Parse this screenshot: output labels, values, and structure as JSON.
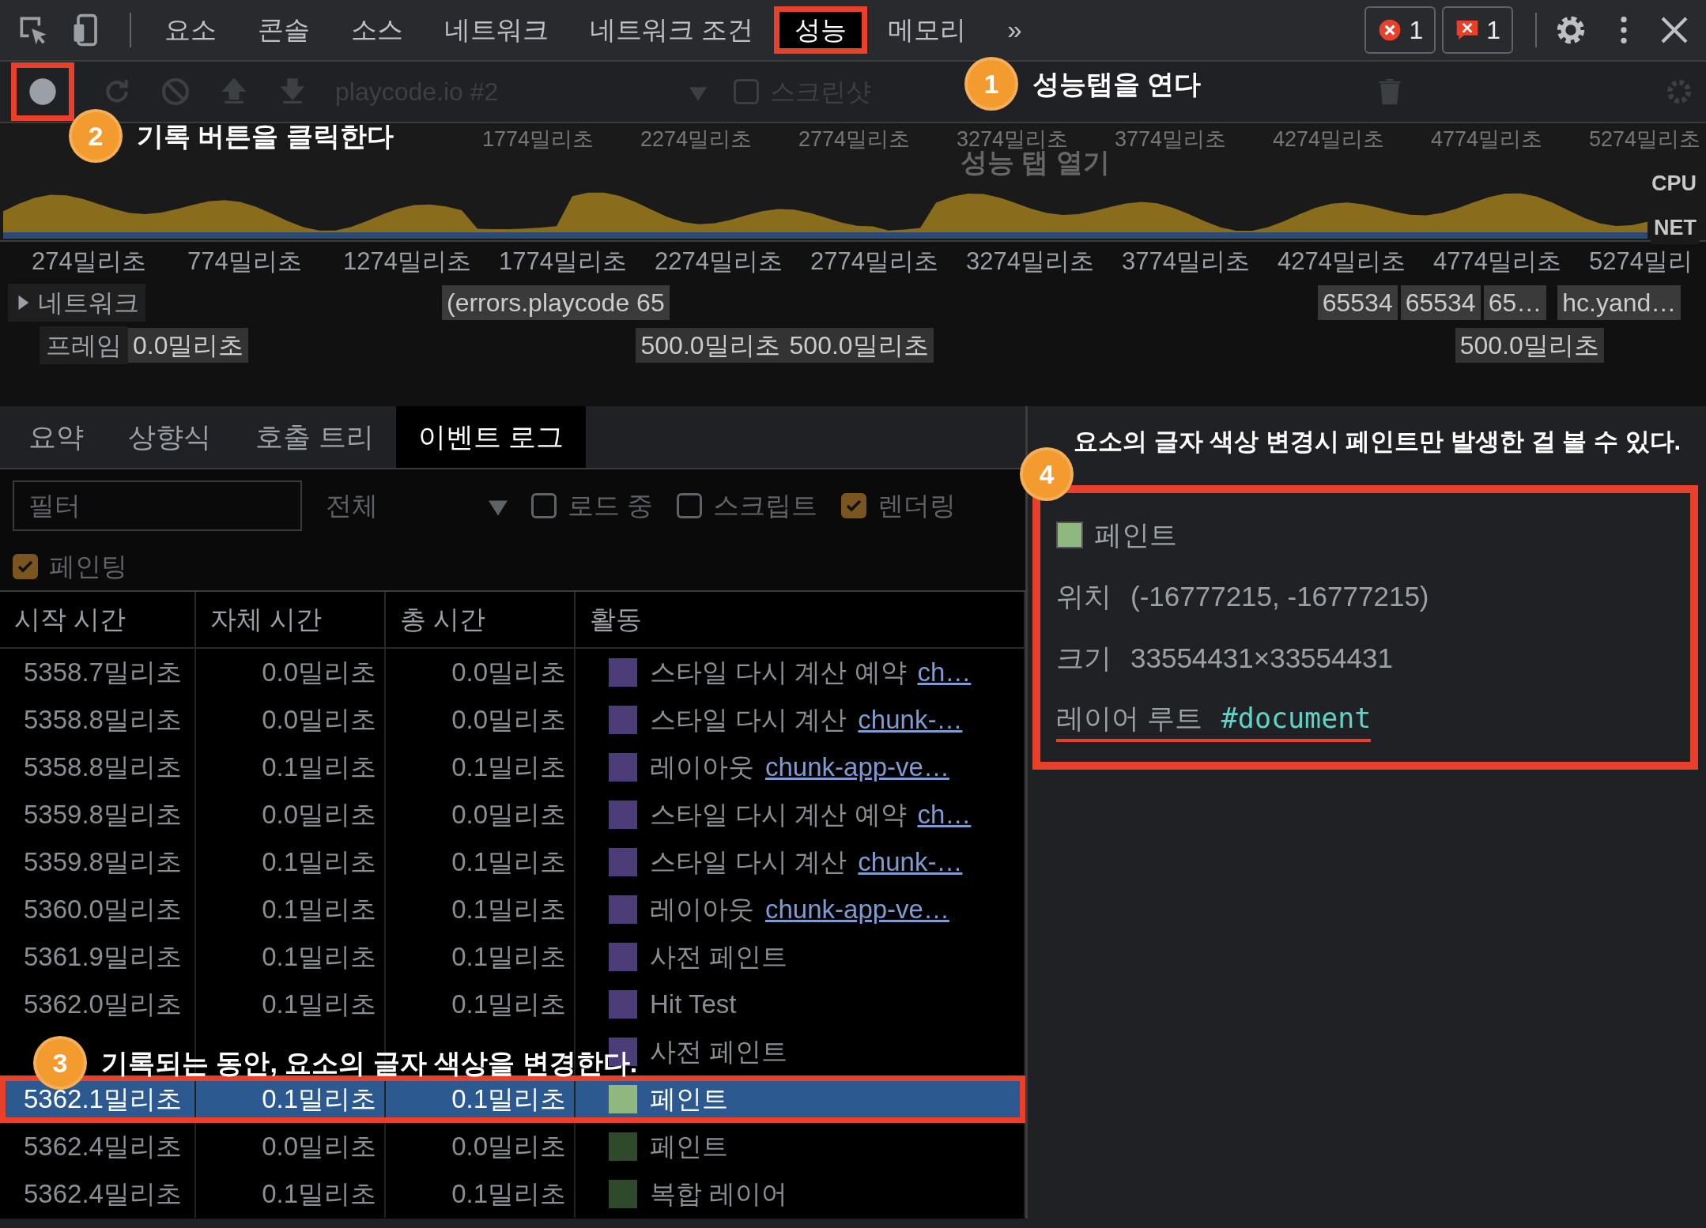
{
  "tabs": [
    {
      "label": "요소",
      "selected": false,
      "highlighted": false
    },
    {
      "label": "콘솔",
      "selected": false,
      "highlighted": false
    },
    {
      "label": "소스",
      "selected": false,
      "highlighted": false
    },
    {
      "label": "네트워크",
      "selected": false,
      "highlighted": false
    },
    {
      "label": "네트워크 조건",
      "selected": false,
      "highlighted": false
    },
    {
      "label": "성능",
      "selected": true,
      "highlighted": true
    },
    {
      "label": "메모리",
      "selected": false,
      "highlighted": false
    },
    {
      "label": "»",
      "selected": false,
      "highlighted": false
    }
  ],
  "counters": [
    {
      "kind": "error",
      "count": "1"
    },
    {
      "kind": "issue",
      "count": "1"
    }
  ],
  "toolbar": {
    "record_highlighted": true,
    "target": "playcode.io #2",
    "checkboxes": [
      {
        "label": "스크린샷",
        "checked": false
      }
    ]
  },
  "overview": {
    "ticks": [
      "1774밀리초",
      "2274밀리초",
      "2774밀리초",
      "3274밀리초",
      "3774밀리초",
      "4274밀리초",
      "4774밀리초",
      "5274밀리초"
    ],
    "screenshot_text": "성능 탭 열기",
    "cpu_label": "CPU",
    "net_label": "NET"
  },
  "ruler": [
    "274밀리초",
    "774밀리초",
    "1274밀리초",
    "1774밀리초",
    "2274밀리초",
    "2774밀리초",
    "3274밀리초",
    "3774밀리초",
    "4274밀리초",
    "4774밀리초",
    "5274밀리"
  ],
  "network_track": {
    "label": "네트워크",
    "expanded": false,
    "segments": [
      "(errors.playcode 65",
      "65534",
      "65534",
      "65…",
      "hc.yand…"
    ]
  },
  "frames_track": {
    "label": "프레임",
    "segments": [
      "0.0밀리초",
      "500.0밀리초",
      "500.0밀리초",
      "500.0밀리초"
    ]
  },
  "detail_tabs": [
    {
      "label": "요약",
      "selected": false
    },
    {
      "label": "상향식",
      "selected": false
    },
    {
      "label": "호출 트리",
      "selected": false
    },
    {
      "label": "이벤트 로그",
      "selected": true
    }
  ],
  "filter": {
    "placeholder": "필터",
    "category": "전체",
    "checkboxes": [
      {
        "label": "로드 중",
        "checked": false
      },
      {
        "label": "스크립트",
        "checked": false
      },
      {
        "label": "렌더링",
        "checked": true
      },
      {
        "label": "페인팅",
        "checked": true
      }
    ]
  },
  "table": {
    "columns": [
      "시작 시간",
      "자체 시간",
      "총 시간",
      "활동"
    ],
    "rows": [
      {
        "start": "5358.7밀리초",
        "self": "0.0밀리초",
        "total": "0.0밀리초",
        "activity": "스타일 다시 계산 예약",
        "link": "ch…",
        "color": "#4c3d78",
        "selected": false
      },
      {
        "start": "5358.8밀리초",
        "self": "0.0밀리초",
        "total": "0.0밀리초",
        "activity": "스타일 다시 계산",
        "link": "chunk-…",
        "color": "#4c3d78",
        "selected": false
      },
      {
        "start": "5358.8밀리초",
        "self": "0.1밀리초",
        "total": "0.1밀리초",
        "activity": "레이아웃",
        "link": "chunk-app-ve…",
        "color": "#4c3d78",
        "selected": false
      },
      {
        "start": "5359.8밀리초",
        "self": "0.0밀리초",
        "total": "0.0밀리초",
        "activity": "스타일 다시 계산 예약",
        "link": "ch…",
        "color": "#4c3d78",
        "selected": false
      },
      {
        "start": "5359.8밀리초",
        "self": "0.1밀리초",
        "total": "0.1밀리초",
        "activity": "스타일 다시 계산",
        "link": "chunk-…",
        "color": "#4c3d78",
        "selected": false
      },
      {
        "start": "5360.0밀리초",
        "self": "0.1밀리초",
        "total": "0.1밀리초",
        "activity": "레이아웃",
        "link": "chunk-app-ve…",
        "color": "#4c3d78",
        "selected": false
      },
      {
        "start": "5361.9밀리초",
        "self": "0.1밀리초",
        "total": "0.1밀리초",
        "activity": "사전 페인트",
        "color": "#4c3d78",
        "selected": false
      },
      {
        "start": "5362.0밀리초",
        "self": "0.1밀리초",
        "total": "0.1밀리초",
        "activity": "Hit Test",
        "color": "#4c3d78",
        "selected": false
      },
      {
        "activity": "사전 페인트",
        "color": "#4c3d78",
        "selected": false
      },
      {
        "start": "5362.1밀리초",
        "self": "0.1밀리초",
        "total": "0.1밀리초",
        "activity": "페인트",
        "color": "#8fb77f",
        "selected": true
      },
      {
        "start": "5362.4밀리초",
        "self": "0.0밀리초",
        "total": "0.0밀리초",
        "activity": "페인트",
        "color": "#2e4a2b",
        "selected": false
      },
      {
        "start": "5362.4밀리초",
        "self": "0.1밀리초",
        "total": "0.1밀리초",
        "activity": "복합 레이어",
        "color": "#2e4a2b",
        "selected": false
      }
    ]
  },
  "details": {
    "title": "페인트",
    "color": "#8fb77f",
    "highlighted": true,
    "fields": [
      {
        "label": "위치",
        "value": "(-16777215, -16777215)",
        "kind": "text",
        "underlined": false
      },
      {
        "label": "크기",
        "value": "33554431×33554431",
        "kind": "text",
        "underlined": false
      },
      {
        "label": "레이어 루트",
        "value": "#document",
        "kind": "code",
        "underlined": true
      }
    ]
  },
  "annotations": [
    {
      "number": "1",
      "text": "성능탭을 연다"
    },
    {
      "number": "2",
      "text": "기록 버튼을 클릭한다"
    },
    {
      "number": "3",
      "text": "기록되는 동안, 요소의 글자 색상을 변경한다."
    },
    {
      "number": "4",
      "text": "요소의 글자 색상 변경시 페인트만 발생한 걸 볼 수 있다."
    }
  ]
}
